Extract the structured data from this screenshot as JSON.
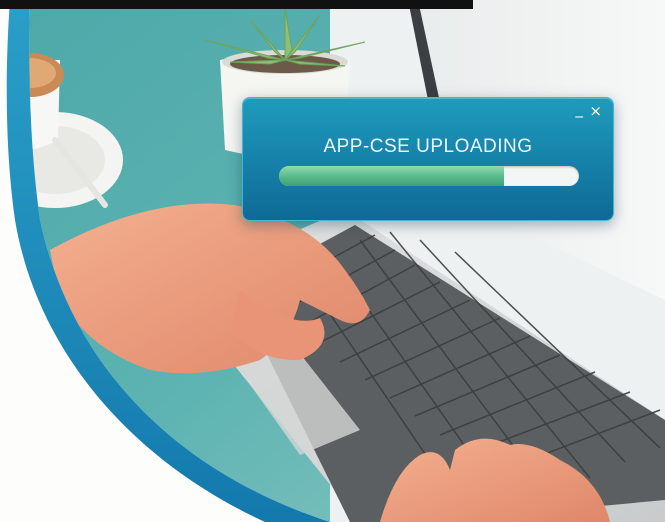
{
  "top_strip_text": "",
  "upload_dialog": {
    "title": "APP-CSE UPLOADING",
    "minimize_glyph": "_",
    "close_glyph": "×",
    "progress_fraction": 0.75,
    "accent_color": "#1a8fb5",
    "progress_color": "#56b98a"
  }
}
